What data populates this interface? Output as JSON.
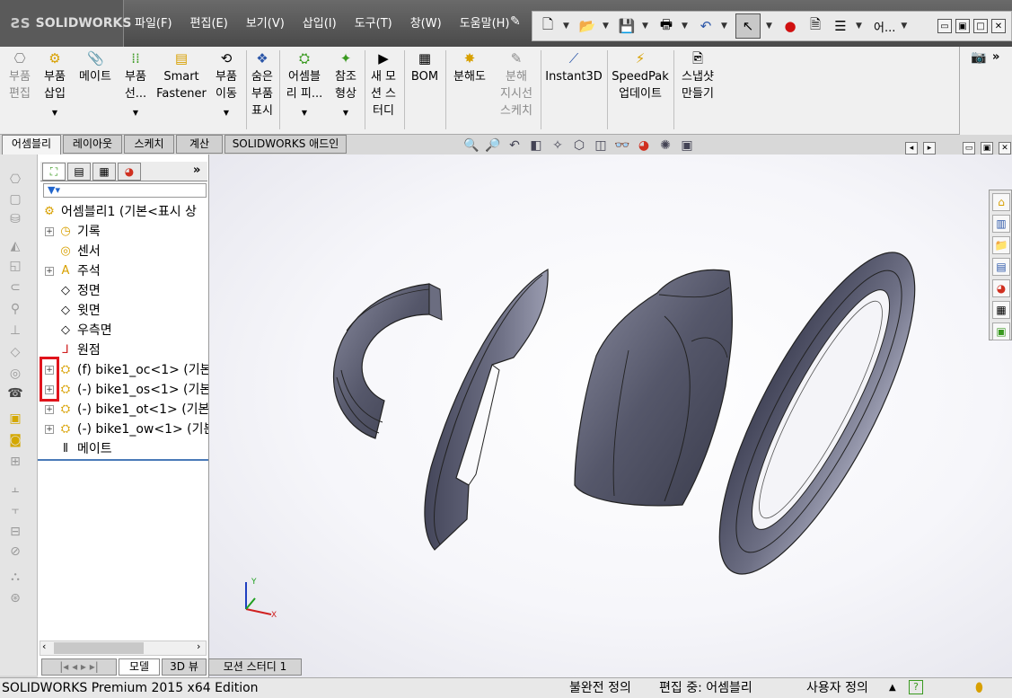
{
  "app": {
    "logo_text": "SOLIDWORKS"
  },
  "menu": [
    "파일(F)",
    "편집(E)",
    "보기(V)",
    "삽입(I)",
    "도구(T)",
    "창(W)",
    "도움말(H)"
  ],
  "quick_access": {
    "search_text": "어..."
  },
  "ribbon": {
    "buttons": [
      {
        "label": "부품\n편집",
        "enabled": false
      },
      {
        "label": "부품\n삽입",
        "enabled": true
      },
      {
        "label": "메이트",
        "enabled": true
      },
      {
        "label": "부품\n선...",
        "enabled": true
      },
      {
        "label": "Smart\nFastener",
        "enabled": true
      },
      {
        "label": "부품\n이동",
        "enabled": true
      },
      {
        "label": "숨은\n부품\n표시",
        "enabled": true
      },
      {
        "label": "어셈블\n리 피...",
        "enabled": true
      },
      {
        "label": "참조\n형상",
        "enabled": true
      },
      {
        "label": "새 모\n션 스\n터디",
        "enabled": true
      },
      {
        "label": "BOM",
        "enabled": true
      },
      {
        "label": "분해도",
        "enabled": true
      },
      {
        "label": "분해\n지시선\n스케치",
        "enabled": false
      },
      {
        "label": "Instant3D",
        "enabled": true
      },
      {
        "label": "SpeedPak\n업데이트",
        "enabled": true
      },
      {
        "label": "스냅샷\n만들기",
        "enabled": true
      }
    ]
  },
  "tabs": [
    "어셈블리",
    "레이아웃",
    "스케치",
    "계산",
    "SOLIDWORKS 애드인"
  ],
  "feature_tree": {
    "root": "어셈블리1  (기본<표시 상",
    "items": [
      {
        "label": "기록",
        "expandable": true
      },
      {
        "label": "센서",
        "expandable": false
      },
      {
        "label": "주석",
        "expandable": true
      },
      {
        "label": "정면",
        "expandable": false
      },
      {
        "label": "윗면",
        "expandable": false
      },
      {
        "label": "우측면",
        "expandable": false
      },
      {
        "label": "원점",
        "expandable": false
      },
      {
        "label": "(f) bike1_oc<1>  (기본<",
        "expandable": true
      },
      {
        "label": "(-) bike1_os<1>  (기본<",
        "expandable": true
      },
      {
        "label": "(-) bike1_ot<1>  (기본<",
        "expandable": true
      },
      {
        "label": "(-) bike1_ow<1>  (기본<",
        "expandable": true
      },
      {
        "label": "메이트",
        "expandable": false
      }
    ]
  },
  "bottom_tabs": [
    "모델",
    "3D 뷰",
    "모션 스터디 1"
  ],
  "triad": {
    "y": "Y",
    "x": "X"
  },
  "status": {
    "edition": "SOLIDWORKS Premium 2015 x64 Edition",
    "definition": "불완전 정의",
    "editing": "편집 중: 어셈블리",
    "units": "사용자 정의"
  },
  "colors": {
    "selection_highlight": "#e0141c",
    "part_fill": "#5b5d70"
  }
}
